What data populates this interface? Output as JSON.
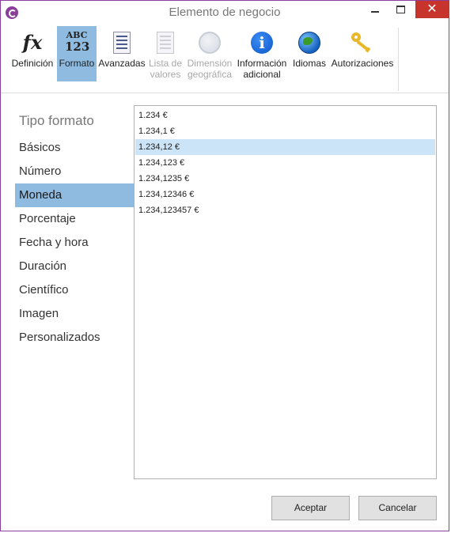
{
  "window": {
    "title": "Elemento de negocio"
  },
  "toolbar": {
    "items": [
      {
        "label": "Definición",
        "icon": "function-fx-icon",
        "active": false,
        "disabled": false
      },
      {
        "label": "Formato",
        "icon": "abc-123-format-icon",
        "active": true,
        "disabled": false
      },
      {
        "label": "Avanzadas",
        "icon": "advanced-document-icon",
        "active": false,
        "disabled": false
      },
      {
        "label": "Lista de valores",
        "icon": "value-list-icon",
        "active": false,
        "disabled": true
      },
      {
        "label": "Dimensión geográfica",
        "icon": "globe-icon",
        "active": false,
        "disabled": true
      },
      {
        "label": "Información adicional",
        "icon": "info-icon",
        "active": false,
        "disabled": false
      },
      {
        "label": "Idiomas",
        "icon": "world-globe-icon",
        "active": false,
        "disabled": false
      },
      {
        "label": "Autorizaciones",
        "icon": "key-icon",
        "active": false,
        "disabled": false
      }
    ]
  },
  "format_types": {
    "title": "Tipo formato",
    "items": [
      "Básicos",
      "Número",
      "Moneda",
      "Porcentaje",
      "Fecha y hora",
      "Duración",
      "Científico",
      "Imagen",
      "Personalizados"
    ],
    "selected_index": 2
  },
  "formats": {
    "items": [
      "1.234 €",
      "1.234,1 €",
      "1.234,12 €",
      "1.234,123 €",
      "1.234,1235 €",
      "1.234,12346 €",
      "1.234,123457 €"
    ],
    "selected_index": 2
  },
  "buttons": {
    "ok": "Aceptar",
    "cancel": "Cancelar"
  },
  "colors": {
    "accent": "#8fbbe0",
    "selection": "#cce4f7",
    "window_border": "#8a3f9a",
    "close": "#c7342b"
  }
}
